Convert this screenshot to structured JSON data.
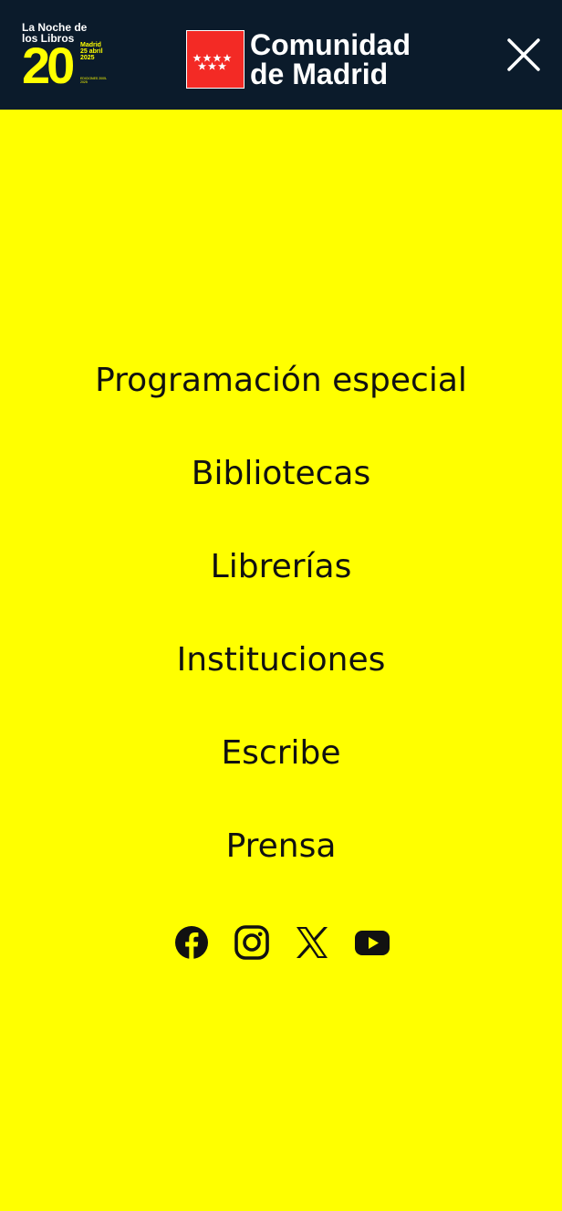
{
  "header": {
    "event_logo": {
      "title": "La Noche de los Libros",
      "number": "20",
      "city": "Madrid",
      "date": "25 abril",
      "year": "2025",
      "editions": "EDICIONES 2005-2025"
    },
    "region_logo": {
      "name_line1": "Comunidad",
      "name_line2": "de Madrid",
      "flag_color": "#F32A25"
    },
    "close_icon": "close-icon"
  },
  "menu": {
    "items": [
      "Programación especial",
      "Bibliotecas",
      "Librerías",
      "Instituciones",
      "Escribe",
      "Prensa"
    ]
  },
  "social": [
    "facebook-icon",
    "instagram-icon",
    "x-icon",
    "youtube-icon"
  ],
  "colors": {
    "header_bg": "#0B1B2B",
    "page_bg": "#FFFF00",
    "text": "#111111",
    "accent": "#FFFF00"
  }
}
